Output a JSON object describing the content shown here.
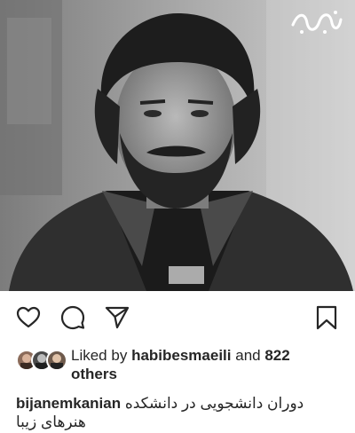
{
  "post": {
    "photo_alt": "",
    "watermark": "برترین‌ها"
  },
  "actions": {
    "like_icon": "heart-icon",
    "comment_icon": "comment-icon",
    "share_icon": "paper-plane-icon",
    "save_icon": "bookmark-icon"
  },
  "likes": {
    "prefix": "Liked by",
    "liker": "habibesmaeili",
    "conjunction": "and",
    "others": "822 others"
  },
  "caption": {
    "username": "bijanemkanian",
    "text": "دوران دانشجویی در دانشکده هنرهای زیبا"
  },
  "colors": {
    "text": "#262626",
    "background": "#ffffff"
  }
}
